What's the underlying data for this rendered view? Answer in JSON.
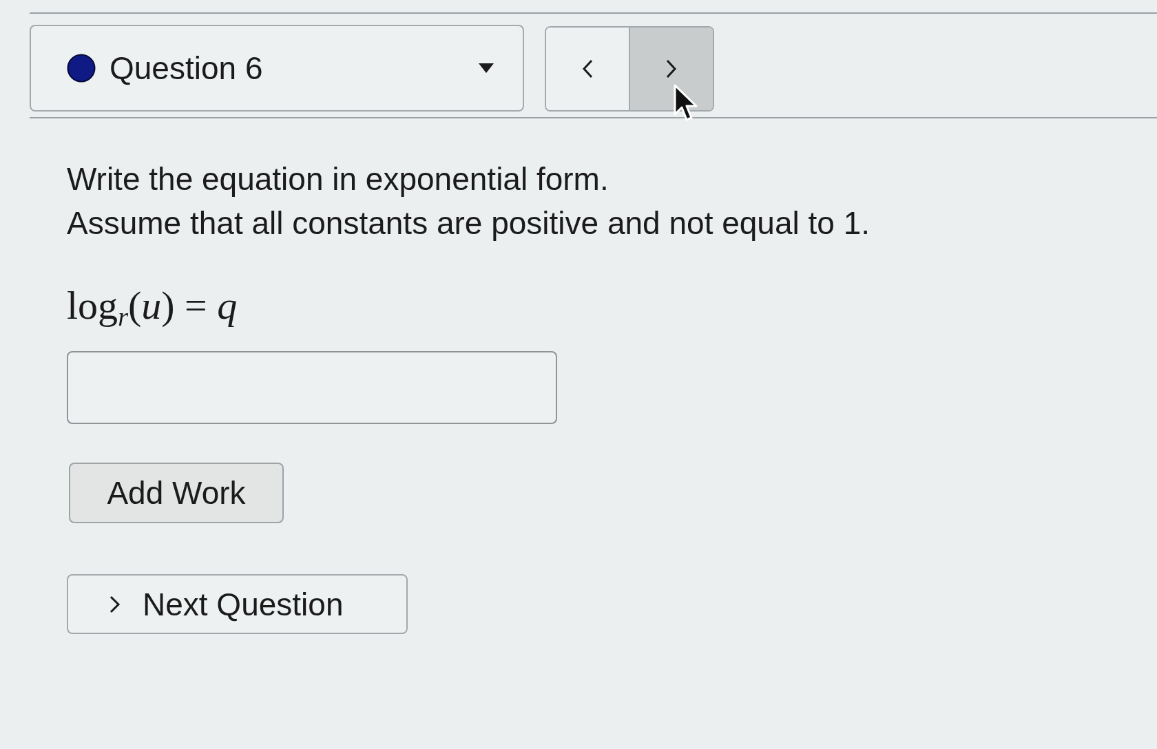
{
  "question_selector": {
    "label": "Question 6"
  },
  "nav_buttons": [
    {
      "kind": "previous",
      "hovered": false
    },
    {
      "kind": "next",
      "hovered": true
    }
  ],
  "prompt": [
    "Write the equation in exponential form.",
    "Assume that all constants are positive and not equal to 1."
  ],
  "equation": "log$_{r}$(*u*) = *q*",
  "buttons": [
    {
      "kind": "add_work",
      "label": "Add Work"
    },
    {
      "kind": "next_question",
      "label": "Next Question"
    }
  ]
}
